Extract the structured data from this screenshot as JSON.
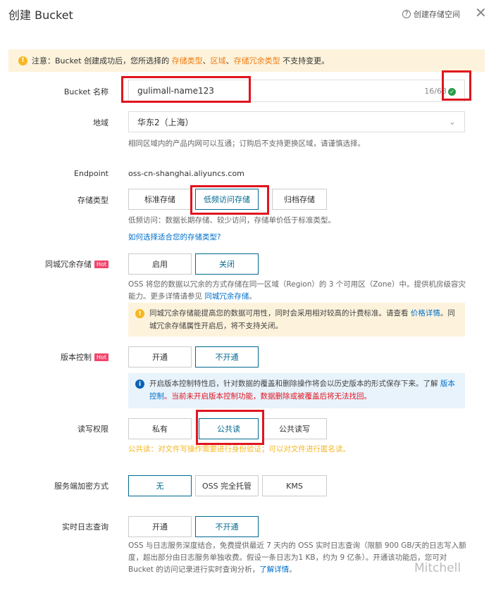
{
  "header": {
    "title": "创建 Bucket",
    "help": "创建存储空间"
  },
  "notice": {
    "prefix": "注意：Bucket 创建成功后，您所选择的 ",
    "link1": "存储类型",
    "sep1": "、",
    "link2": "区域",
    "sep2": "、",
    "link3": "存储冗余类型",
    "suffix": " 不支持变更。"
  },
  "bucket_name": {
    "label": "Bucket 名称",
    "value": "gulimall-name123",
    "counter": "16/63"
  },
  "region": {
    "label": "地域",
    "value": "华东2（上海）",
    "hint": "相同区域内的产品内网可以互通；订购后不支持更换区域，请谨慎选择。"
  },
  "endpoint": {
    "label": "Endpoint",
    "value": "oss-cn-shanghai.aliyuncs.com"
  },
  "storage_class": {
    "label": "存储类型",
    "options": [
      "标准存储",
      "低频访问存储",
      "归档存储"
    ],
    "selected": "低频访问存储",
    "hint": "低频访问：数据长期存储、较少访问，存储单价低于标准类型。",
    "link": "如何选择适合您的存储类型?"
  },
  "zrs": {
    "label": "同城冗余存储",
    "badge": "Hot",
    "options": [
      "启用",
      "关闭"
    ],
    "selected": "关闭",
    "hint": "OSS 将您的数据以冗余的方式存储在同一区域（Region）的 3 个可用区（Zone）中。提供机房级容灾能力。更多详情请参见 ",
    "hint_link": "同城冗余存储",
    "hint_end": "。",
    "warn_text": "同城冗余存储能提高您的数据可用性，同时会采用相对较高的计费标准。请查看 ",
    "warn_link": "价格详情",
    "warn_end": "。同城冗余存储属性开启后，将不支持关闭。"
  },
  "versioning": {
    "label": "版本控制",
    "badge": "Hot",
    "options": [
      "开通",
      "不开通"
    ],
    "selected": "不开通",
    "info_text": "开启版本控制特性后，针对数据的覆盖和删除操作将会以历史版本的形式保存下来。了解 ",
    "info_link": "版本控制",
    "info_warn": "。当前未开启版本控制功能，数据删除或被覆盖后将无法找回。"
  },
  "acl": {
    "label": "读写权限",
    "options": [
      "私有",
      "公共读",
      "公共读写"
    ],
    "selected": "公共读",
    "hint": "公共读：对文件写操作需要进行身份验证；可以对文件进行匿名读。"
  },
  "encryption": {
    "label": "服务端加密方式",
    "options": [
      "无",
      "OSS 完全托管",
      "KMS"
    ],
    "selected": "无"
  },
  "logging": {
    "label": "实时日志查询",
    "options": [
      "开通",
      "不开通"
    ],
    "selected": "不开通",
    "hint": "OSS 与日志服务深度结合，免费提供最近 7 天内的 OSS 实时日志查询（限额 900 GB/天的日志写入额度，超出部分由日志服务单独收费。假设一条日志为1 KB，约为 9 亿条）。开通该功能后，您可对 Bucket 的访问记录进行实时查询分析，",
    "hint_link": "了解详情",
    "hint_end": "。"
  },
  "watermark": "Mitchell",
  "colors": {
    "accent": "#00698f",
    "annotation": "#e0141e",
    "warning": "#f07c10",
    "hot": "#f1446b"
  }
}
